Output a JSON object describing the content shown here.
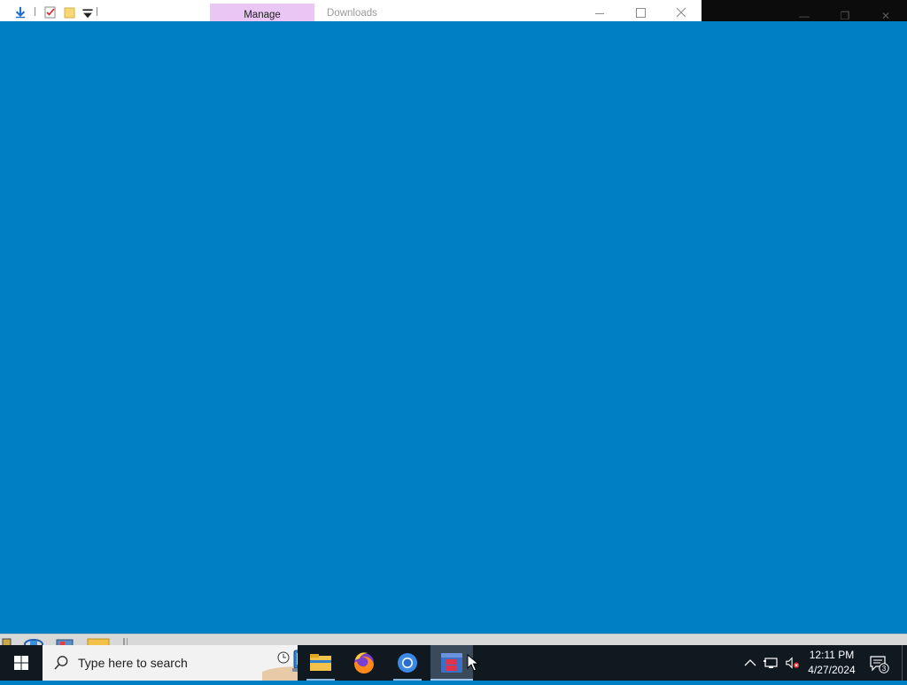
{
  "explorer_window": {
    "ribbon_context_tab": "Manage",
    "title": "Downloads"
  },
  "taskbar": {
    "search_placeholder": "Type here to search",
    "pinned_apps": [
      "file-explorer",
      "firefox",
      "chrome",
      "windows-store"
    ],
    "active_app": "windows-store",
    "clock": {
      "time": "12:11 PM",
      "date": "4/27/2024"
    },
    "notifications_count": "3"
  },
  "colors": {
    "desktop": "#007fc4",
    "taskbar": "#101820",
    "manage_tab": "#e9c6f3"
  }
}
